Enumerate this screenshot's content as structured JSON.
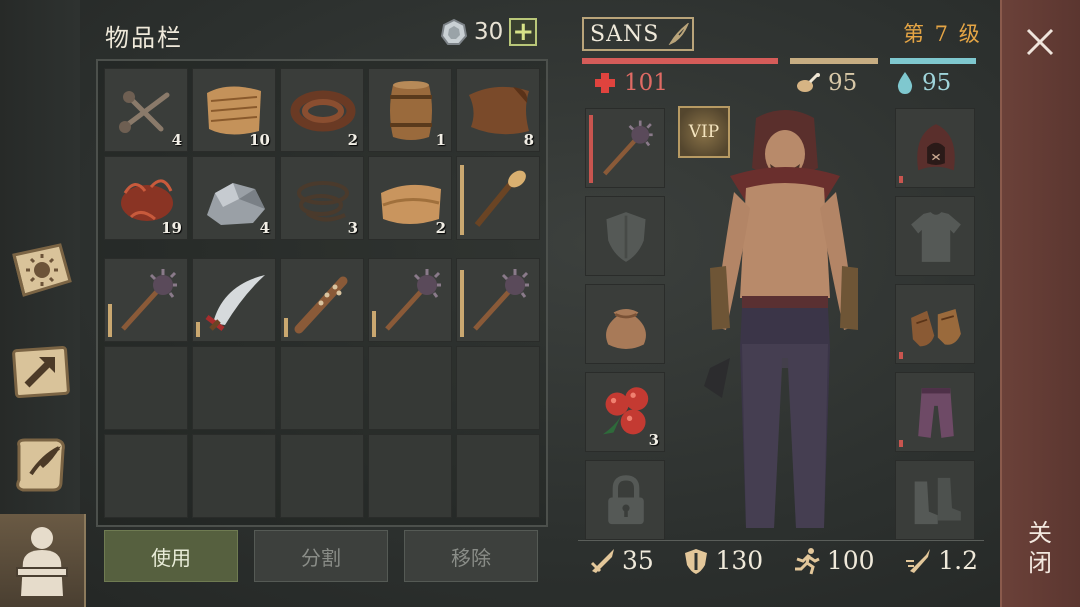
{
  "inventory": {
    "title": "物品栏",
    "coins": "30",
    "plus_label": "+",
    "rows": [
      [
        {
          "icon": "nails-icon",
          "qty": "4"
        },
        {
          "icon": "fiber-bundle-icon",
          "qty": "10"
        },
        {
          "icon": "leather-strap-icon",
          "qty": "2"
        },
        {
          "icon": "barrel-icon",
          "qty": "1"
        },
        {
          "icon": "leather-hide-icon",
          "qty": "8"
        }
      ],
      [
        {
          "icon": "plant-roots-icon",
          "qty": "19"
        },
        {
          "icon": "stone-ore-icon",
          "qty": "4"
        },
        {
          "icon": "rope-icon",
          "qty": "3"
        },
        {
          "icon": "cloth-icon",
          "qty": "2"
        },
        {
          "icon": "torch-icon",
          "qty": "",
          "durability": 0.95
        }
      ],
      [
        {
          "icon": "spiked-mace-icon",
          "qty": "",
          "durability": 0.45
        },
        {
          "icon": "curved-sword-icon",
          "qty": "",
          "durability": 0.2
        },
        {
          "icon": "spiked-club-icon",
          "qty": "",
          "durability": 0.25
        },
        {
          "icon": "spiked-mace-icon",
          "qty": "",
          "durability": 0.35
        },
        {
          "icon": "spiked-mace-icon",
          "qty": "",
          "durability": 0.9
        }
      ]
    ],
    "empty_rows": 2
  },
  "actions": {
    "use_label": "使用",
    "split_label": "分割",
    "remove_label": "移除"
  },
  "character": {
    "name": "SANS",
    "level": "第 7 级",
    "health": "101",
    "food": "95",
    "water": "95",
    "vip_label": "VIP",
    "equip_left": [
      {
        "icon": "spiked-mace-icon",
        "qty": "",
        "durability": 0.95
      },
      {
        "icon": "shield-icon",
        "qty": ""
      },
      {
        "icon": "sack-icon",
        "qty": ""
      },
      {
        "icon": "berries-icon",
        "qty": "3"
      },
      {
        "icon": "lock-icon",
        "qty": ""
      }
    ],
    "equip_right": [
      {
        "icon": "hood-icon",
        "qty": "",
        "durability": 0.1
      },
      {
        "icon": "shirt-icon",
        "qty": ""
      },
      {
        "icon": "gloves-icon",
        "qty": "",
        "durability": 0.1
      },
      {
        "icon": "pants-icon",
        "qty": "",
        "durability": 0.1
      },
      {
        "icon": "boots-icon",
        "qty": ""
      }
    ],
    "stats": {
      "attack": "35",
      "armor": "130",
      "speed": "100",
      "attack_speed": "1.2"
    }
  },
  "close": {
    "label": "关闭"
  },
  "colors": {
    "health": "#d55c59",
    "food": "#c7ad82",
    "water": "#7fc8cf",
    "level": "#e5a545",
    "use_button": "#56603f"
  }
}
